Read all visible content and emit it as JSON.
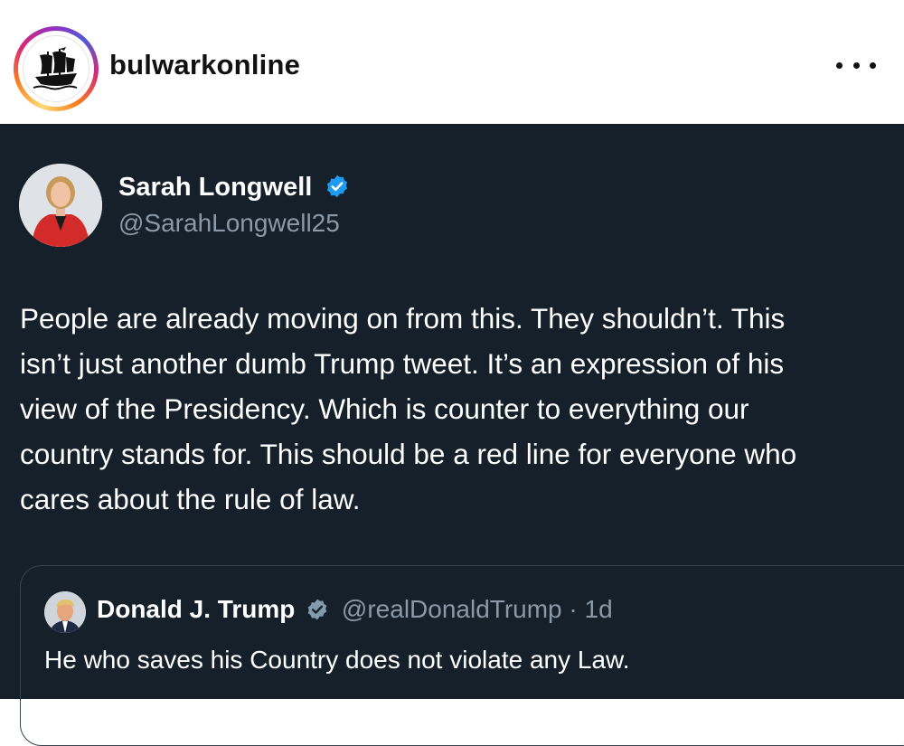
{
  "post": {
    "username": "bulwarkonline"
  },
  "tweet": {
    "author_name": "Sarah Longwell",
    "author_handle": "@SarahLongwell25",
    "lines": [
      "People are already moving on from this. They shouldn’t. This",
      "isn’t just another dumb Trump tweet. It’s an expression of his",
      "view of the Presidency. Which is counter to everything our",
      "country stands for. This should be a red line for everyone who",
      "cares about the rule of law."
    ]
  },
  "quoted": {
    "author_name": "Donald J. Trump",
    "author_handle": "@realDonaldTrump",
    "separator": "·",
    "age": "1d",
    "text": "He who saves his Country does not violate any Law."
  },
  "colors": {
    "tweet_bg": "#15202b",
    "verified_blue": "#1d9bf0",
    "muted_text": "#8b98a5"
  },
  "icons": {
    "profile_logo": "ship-logo-icon",
    "more": "more-horizontal-icon",
    "verified": "verified-badge-icon"
  }
}
